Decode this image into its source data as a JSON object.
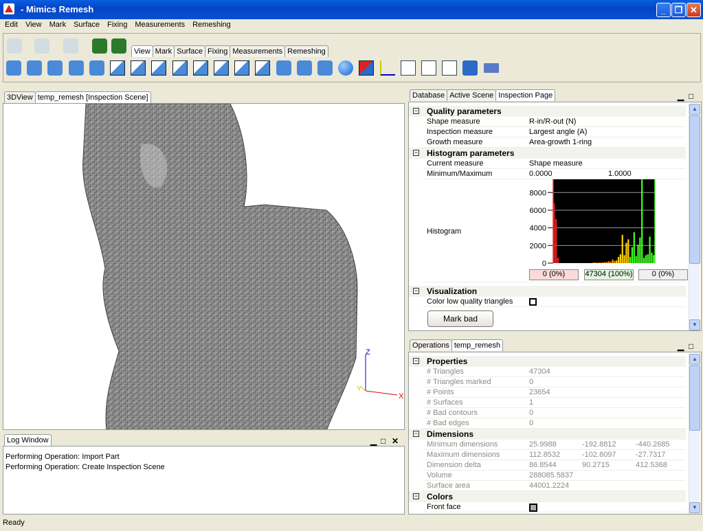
{
  "window": {
    "title": "- Mimics Remesh",
    "minimize": "_",
    "maximize": "❐",
    "close": "✕"
  },
  "menu": [
    "Edit",
    "View",
    "Mark",
    "Surface",
    "Fixing",
    "Measurements",
    "Remeshing"
  ],
  "toolbar": {
    "tabs": [
      "View",
      "Mark",
      "Surface",
      "Fixing",
      "Measurements",
      "Remeshing"
    ],
    "active_tab": "View",
    "row1_icons": [
      "undo-icon",
      "redo-icon",
      "select-disabled-icon",
      "select-part-icon",
      "select-part-alt-icon"
    ],
    "row2_icons": [
      "pan-icon",
      "rotate-icon",
      "zoom-in-icon",
      "zoom-out-icon",
      "zoom-region-icon",
      "view-front-icon",
      "view-back-icon",
      "view-left-icon",
      "view-right-icon",
      "view-top-icon",
      "view-bottom-icon",
      "view-iso-icon",
      "wireframe-icon",
      "shaded-icon",
      "shaded-edges-icon",
      "triangles-icon",
      "sphere-icon",
      "backface-icon",
      "axes-icon",
      "panel-list-icon",
      "panel-tree-icon",
      "panel-props-icon",
      "settings-icon",
      "keyboard-icon"
    ]
  },
  "left_tabs": [
    "3DView",
    "temp_remesh [Inspection Scene]"
  ],
  "viewport": {
    "axis_z": "Z",
    "axis_y": "Y",
    "axis_x": "X",
    "mesh_color": "#9a9a9a"
  },
  "log": {
    "title": "Log Window",
    "lines": [
      "Performing Operation: Import Part",
      "Performing Operation: Create Inspection Scene"
    ]
  },
  "inspection": {
    "tabs": [
      "Database",
      "Active Scene",
      "Inspection Page"
    ],
    "quality_title": "Quality parameters",
    "quality": [
      [
        "Shape measure",
        "R-in/R-out (N)"
      ],
      [
        "Inspection measure",
        "Largest angle (A)"
      ],
      [
        "Growth measure",
        "Area-growth 1-ring"
      ]
    ],
    "histogram_title": "Histogram parameters",
    "current_measure": [
      "Current measure",
      "Shape measure"
    ],
    "minmax": [
      "Minimum/Maximum",
      "0.0000",
      "1.0000"
    ],
    "histogram_label": "Histogram",
    "counts": [
      "0 (0%)",
      "47304 (100%)",
      "0 (0%)"
    ],
    "visualization_title": "Visualization",
    "color_low": "Color low quality triangles",
    "color_low_checked": false,
    "mark_bad": "Mark bad"
  },
  "chart_data": {
    "type": "bar",
    "xlim": [
      0,
      1
    ],
    "ylim": [
      0,
      9500
    ],
    "yticks": [
      "0",
      "2000",
      "4000",
      "6000",
      "8000"
    ],
    "y_tick_values": [
      0,
      2000,
      4000,
      6000,
      8000
    ],
    "grid": true,
    "values": [
      6800,
      5000,
      600,
      0,
      0,
      0,
      0,
      0,
      0,
      0,
      0,
      0,
      0,
      0,
      0,
      0,
      0,
      0,
      0,
      0,
      50,
      80,
      30,
      60,
      40,
      80,
      100,
      120,
      200,
      150,
      400,
      250,
      300,
      700,
      1000,
      3200,
      900,
      2300,
      2700,
      700,
      1800,
      3500,
      800,
      2100,
      2900,
      9500,
      600,
      900,
      1000,
      3000,
      1200,
      900
    ],
    "bar_colors": {
      "low": "#ff2020",
      "mid": "#ffd000",
      "high": "#40ff20"
    }
  },
  "part": {
    "tabs": [
      "Operations",
      "temp_remesh"
    ],
    "properties_title": "Properties",
    "properties": [
      [
        "# Triangles",
        "47304"
      ],
      [
        "# Triangles marked",
        "0"
      ],
      [
        "# Points",
        "23654"
      ],
      [
        "# Surfaces",
        "1"
      ],
      [
        "# Bad contours",
        "0"
      ],
      [
        "# Bad edges",
        "0"
      ]
    ],
    "dimensions_title": "Dimensions",
    "dimensions": [
      [
        "Minimum dimensions",
        "25.9988",
        "-192.8812",
        "-440.2685"
      ],
      [
        "Maximum dimensions",
        "112.8532",
        "-102.6097",
        "-27.7317"
      ],
      [
        "Dimension delta",
        "86.8544",
        "90.2715",
        "412.5368"
      ],
      [
        "Volume",
        "288085.5837"
      ],
      [
        "Surface area",
        "44001.2224"
      ]
    ],
    "colors_title": "Colors",
    "front_face": "Front face"
  },
  "status": "Ready"
}
